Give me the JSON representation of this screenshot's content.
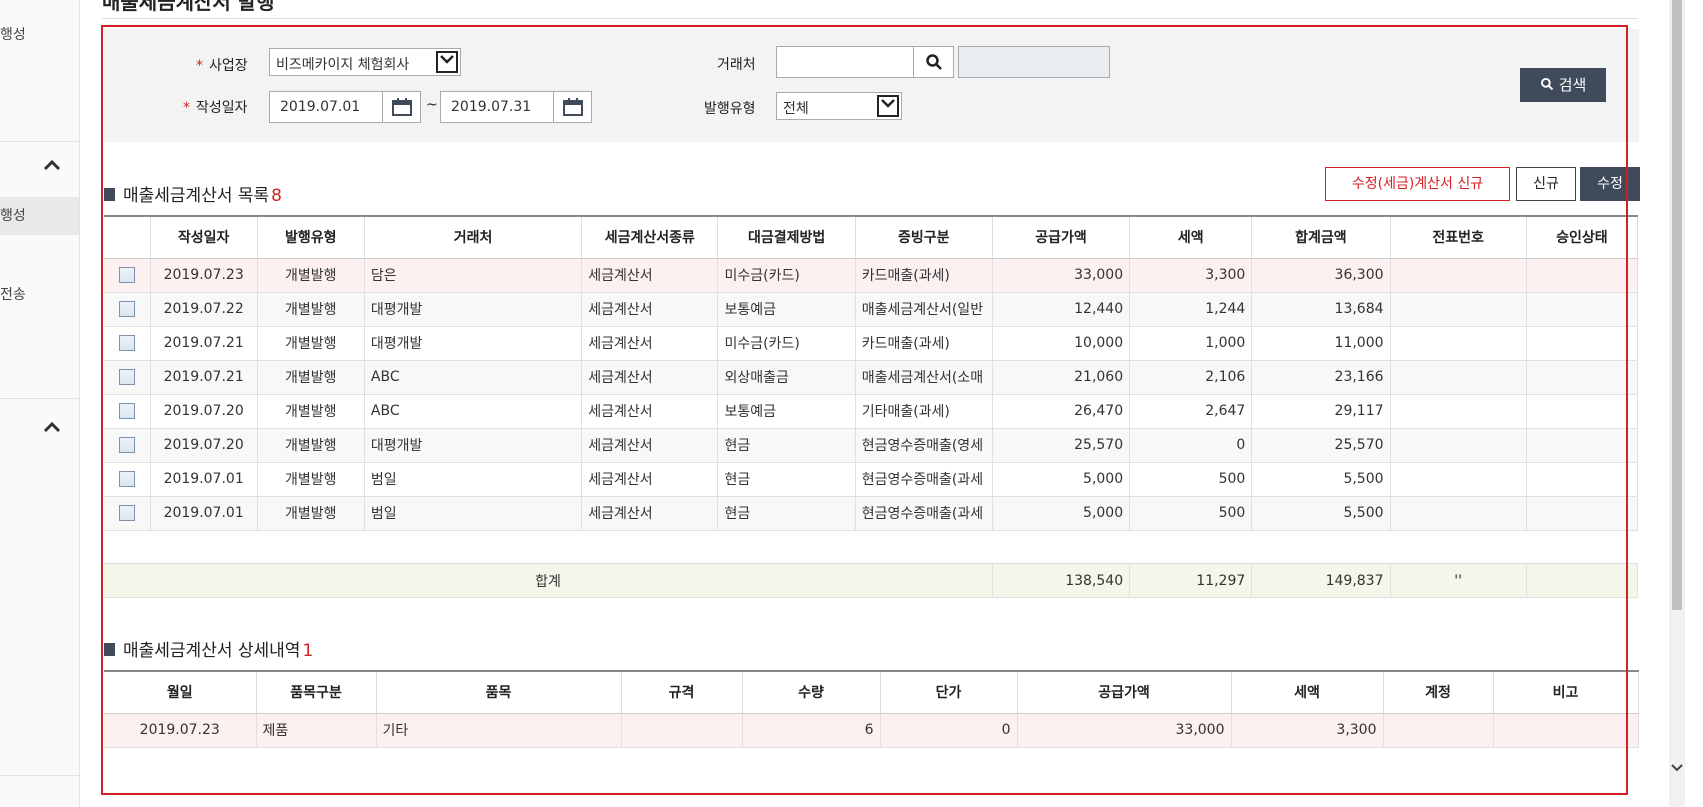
{
  "sidebar": {
    "items": [
      {
        "label": "행성"
      },
      {
        "label": "행성"
      },
      {
        "label": "전송"
      }
    ]
  },
  "page": {
    "title": "매출세금계산서 발행"
  },
  "search": {
    "business_label": "사업장",
    "business_value": "비즈메카이지 체험회사",
    "date_label": "작성일자",
    "date_from": "2019.07.01",
    "date_sep": "~",
    "date_to": "2019.07.31",
    "client_label": "거래처",
    "client_value": "",
    "client_name": "",
    "issue_type_label": "발행유형",
    "issue_type_value": "전체",
    "search_button": "검색"
  },
  "list": {
    "title": "매출세금계산서 목록",
    "count": "8",
    "btn_modify_new": "수정(세금)계산서 신규",
    "btn_new": "신규",
    "btn_edit": "수정",
    "columns": [
      "작성일자",
      "발행유형",
      "거래처",
      "세금계산서종류",
      "대금결제방법",
      "증빙구분",
      "공급가액",
      "세액",
      "합계금액",
      "전표번호",
      "승인상태"
    ],
    "rows": [
      {
        "date": "2019.07.23",
        "type": "개별발행",
        "client": "담은",
        "kind": "세금계산서",
        "pay": "미수금(카드)",
        "proof": "카드매출(과세)",
        "supply": "33,000",
        "tax": "3,300",
        "total": "36,300",
        "voucher": "",
        "status": ""
      },
      {
        "date": "2019.07.22",
        "type": "개별발행",
        "client": "대평개발",
        "kind": "세금계산서",
        "pay": "보통예금",
        "proof": "매출세금계산서(일반",
        "supply": "12,440",
        "tax": "1,244",
        "total": "13,684",
        "voucher": "",
        "status": ""
      },
      {
        "date": "2019.07.21",
        "type": "개별발행",
        "client": "대평개발",
        "kind": "세금계산서",
        "pay": "미수금(카드)",
        "proof": "카드매출(과세)",
        "supply": "10,000",
        "tax": "1,000",
        "total": "11,000",
        "voucher": "",
        "status": ""
      },
      {
        "date": "2019.07.21",
        "type": "개별발행",
        "client": "ABC",
        "kind": "세금계산서",
        "pay": "외상매출금",
        "proof": "매출세금계산서(소매",
        "supply": "21,060",
        "tax": "2,106",
        "total": "23,166",
        "voucher": "",
        "status": ""
      },
      {
        "date": "2019.07.20",
        "type": "개별발행",
        "client": "ABC",
        "kind": "세금계산서",
        "pay": "보통예금",
        "proof": "기타매출(과세)",
        "supply": "26,470",
        "tax": "2,647",
        "total": "29,117",
        "voucher": "",
        "status": ""
      },
      {
        "date": "2019.07.20",
        "type": "개별발행",
        "client": "대평개발",
        "kind": "세금계산서",
        "pay": "현금",
        "proof": "현금영수증매출(영세",
        "supply": "25,570",
        "tax": "0",
        "total": "25,570",
        "voucher": "",
        "status": ""
      },
      {
        "date": "2019.07.01",
        "type": "개별발행",
        "client": "범일",
        "kind": "세금계산서",
        "pay": "현금",
        "proof": "현금영수증매출(과세",
        "supply": "5,000",
        "tax": "500",
        "total": "5,500",
        "voucher": "",
        "status": ""
      },
      {
        "date": "2019.07.01",
        "type": "개별발행",
        "client": "범일",
        "kind": "세금계산서",
        "pay": "현금",
        "proof": "현금영수증매출(과세",
        "supply": "5,000",
        "tax": "500",
        "total": "5,500",
        "voucher": "",
        "status": ""
      }
    ],
    "sum_label": "합계",
    "sum_supply": "138,540",
    "sum_tax": "11,297",
    "sum_total": "149,837",
    "sum_voucher": "''"
  },
  "detail": {
    "title": "매출세금계산서 상세내역",
    "count": "1",
    "columns": [
      "월일",
      "품목구분",
      "품목",
      "규격",
      "수량",
      "단가",
      "공급가액",
      "세액",
      "계정",
      "비고"
    ],
    "rows": [
      {
        "date": "2019.07.23",
        "category": "제품",
        "item": "기타",
        "spec": "",
        "qty": "6",
        "price": "0",
        "supply": "33,000",
        "tax": "3,300",
        "account": "",
        "note": ""
      }
    ]
  }
}
